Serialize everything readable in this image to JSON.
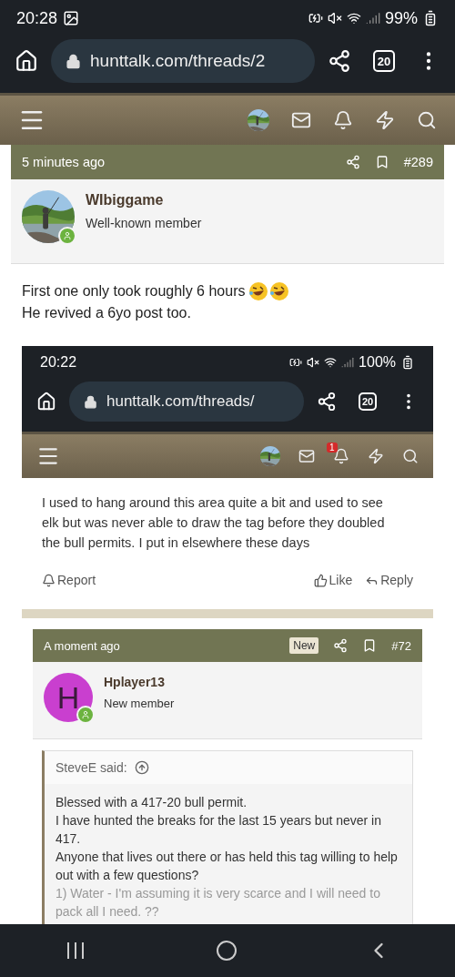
{
  "status_bar": {
    "time": "20:28",
    "battery": "99%"
  },
  "browser": {
    "url": "hunttalk.com/threads/2",
    "tab_count": "20"
  },
  "post": {
    "time": "5 minutes ago",
    "number": "#289",
    "author": "WIbiggame",
    "role": "Well-known member",
    "lines": [
      "First one only took roughly 6 hours",
      "He revived a 6yo post too."
    ],
    "emojis": [
      {
        "kind": "laughing"
      },
      {
        "kind": "laughing"
      }
    ],
    "screenshot": {
      "status_bar": {
        "time": "20:22",
        "battery": "100%"
      },
      "browser": {
        "url": "hunttalk.com/threads/",
        "tab_count": "20"
      },
      "alert_badge": "1",
      "message": "I used to hang around this area quite a bit and used to see elk but was never able to draw the tag before they doubled the bull permits. I put in elsewhere these days",
      "actions": [
        {
          "kind": "report",
          "label": "Report"
        },
        {
          "kind": "like",
          "label": "Like"
        },
        {
          "kind": "reply",
          "label": "Reply"
        }
      ],
      "reply": {
        "time": "A moment ago",
        "badge": "New",
        "number": "#72",
        "author": "Hplayer13",
        "role": "New member",
        "avatar_letter": "H",
        "quote": {
          "author": "SteveE said:",
          "paragraphs": [
            {
              "text": "Blessed with a 417-20 bull permit.",
              "faded": false
            },
            {
              "text": "I have hunted the breaks for the last 15 years but never in 417.",
              "faded": false
            },
            {
              "text": "Anyone that lives out there or has held this tag willing to help out with a few questions?",
              "faded": false
            },
            {
              "text": "1) Water - I'm assuming it is very scarce and I will need to pack all I need. ??",
              "faded": true
            }
          ]
        }
      }
    }
  }
}
